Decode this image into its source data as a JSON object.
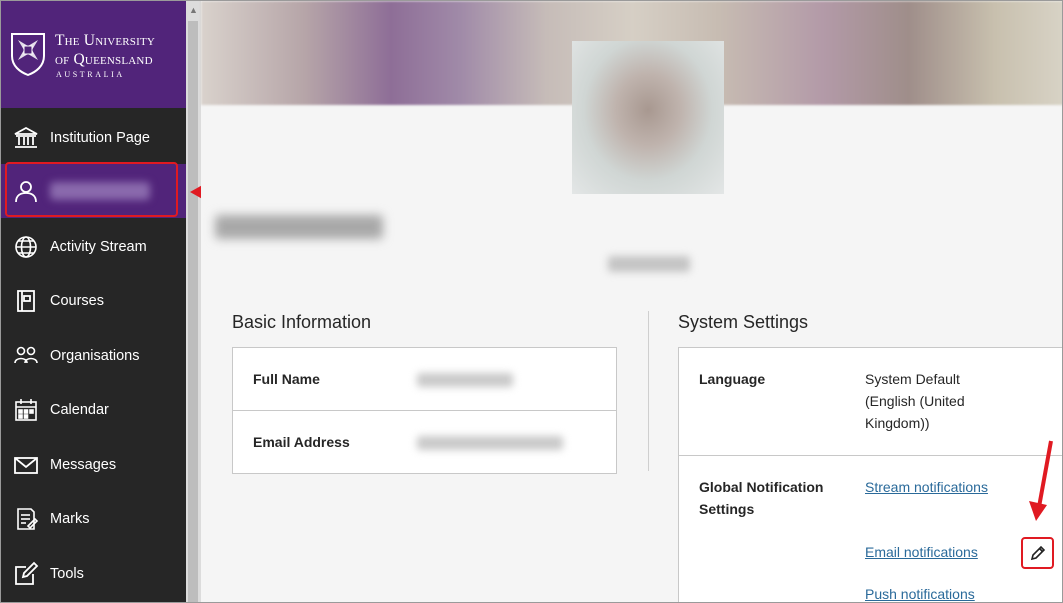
{
  "brand": {
    "line1": "The University",
    "line2": "of Queensland",
    "line3": "AUSTRALIA",
    "color": "#51247a"
  },
  "nav": {
    "items": [
      {
        "label": "Institution Page",
        "icon": "institution-icon"
      },
      {
        "label": "",
        "icon": "user-icon",
        "active": true
      },
      {
        "label": "Activity Stream",
        "icon": "globe-icon"
      },
      {
        "label": "Courses",
        "icon": "courses-icon"
      },
      {
        "label": "Organisations",
        "icon": "organisations-icon"
      },
      {
        "label": "Calendar",
        "icon": "calendar-icon"
      },
      {
        "label": "Messages",
        "icon": "messages-icon"
      },
      {
        "label": "Marks",
        "icon": "marks-icon"
      },
      {
        "label": "Tools",
        "icon": "tools-icon"
      }
    ]
  },
  "basic_info": {
    "title": "Basic Information",
    "full_name_label": "Full Name",
    "email_label": "Email Address"
  },
  "system_settings": {
    "title": "System Settings",
    "language_label": "Language",
    "language_line1": "System Default",
    "language_line2": "(English (United",
    "language_line3": "Kingdom))",
    "notif_label_line1": "Global Notification",
    "notif_label_line2": "Settings",
    "stream_link": "Stream notifications",
    "email_link": "Email notifications",
    "push_link": "Push notifications"
  },
  "annotation_color": "#e01a22"
}
